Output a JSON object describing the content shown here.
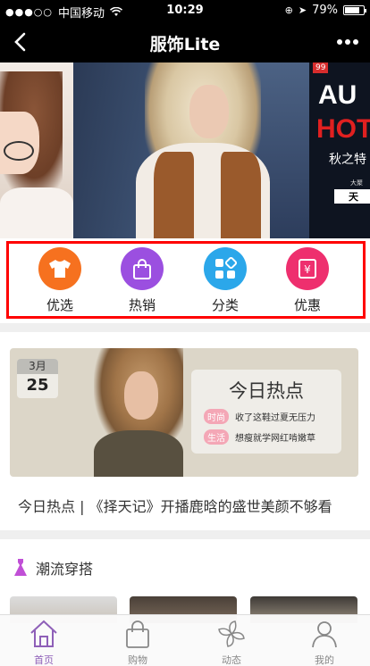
{
  "status_bar": {
    "carrier": "中国移动",
    "time": "10:29",
    "battery": "79%"
  },
  "nav": {
    "title": "服饰Lite"
  },
  "banner": {
    "right_tag": "99",
    "right_big1": "AU",
    "right_big2": "HOT",
    "right_sub": "秋之特",
    "right_small": "大聚",
    "right_bar": "天"
  },
  "menu": {
    "items": [
      {
        "label": "优选",
        "color": "#f6711f",
        "icon": "tshirt-icon"
      },
      {
        "label": "热销",
        "color": "#9b4fe0",
        "icon": "shopping-bag-icon"
      },
      {
        "label": "分类",
        "color": "#2ba7ea",
        "icon": "grid-icon"
      },
      {
        "label": "优惠",
        "color": "#ee2f6e",
        "icon": "coupon-icon"
      }
    ]
  },
  "hot": {
    "month": "3月",
    "day": "25",
    "panel_title": "今日热点",
    "rows": [
      {
        "tag": "时尚",
        "text": "收了这鞋过夏无压力"
      },
      {
        "tag": "生活",
        "text": "想瘦就学网红啃嫩草"
      }
    ],
    "caption": "今日热点 | 《择天记》开播鹿晗的盛世美颜不够看"
  },
  "trend": {
    "label": "潮流穿搭",
    "accent": "#c04fd6"
  },
  "tabbar": {
    "items": [
      {
        "label": "首页",
        "icon": "home-icon",
        "active": true
      },
      {
        "label": "购物",
        "icon": "bag-icon",
        "active": false
      },
      {
        "label": "动态",
        "icon": "pinwheel-icon",
        "active": false
      },
      {
        "label": "我的",
        "icon": "user-icon",
        "active": false
      }
    ]
  }
}
